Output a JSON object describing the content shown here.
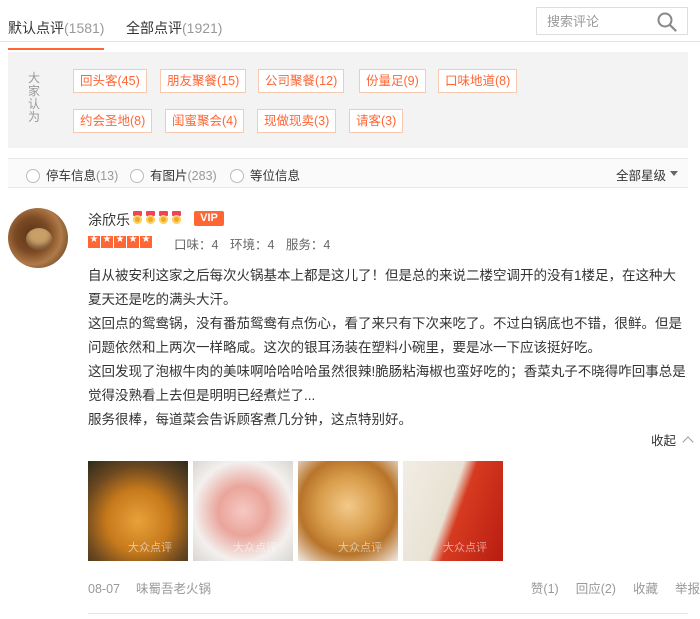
{
  "tabs": [
    {
      "label": "默认点评",
      "count": "(1581)"
    },
    {
      "label": "全部点评",
      "count": "(1921)"
    }
  ],
  "search": {
    "placeholder": "搜索评论"
  },
  "tag_panel": {
    "title": "大家认为",
    "tags": [
      "回头客(45)",
      "朋友聚餐(15)",
      "公司聚餐(12)",
      "份量足(9)",
      "口味地道(8)",
      "约会圣地(8)",
      "闺蜜聚会(4)",
      "现做现卖(3)",
      "请客(3)"
    ]
  },
  "filters": [
    {
      "label": "停车信息",
      "count": "(13)"
    },
    {
      "label": "有图片",
      "count": "(283)"
    },
    {
      "label": "等位信息",
      "count": ""
    }
  ],
  "star_filter": {
    "selected": "全部星级"
  },
  "review": {
    "user": "涂欣乐",
    "vip_label": "VIP",
    "rating_stars": 5,
    "scores": [
      "口味：4",
      "环境：4",
      "服务：4"
    ],
    "paragraphs": [
      "自从被安利这家之后每次火锅基本上都是这儿了！但是总的来说二楼空调开的没有1楼足，在这种大夏天还是吃的满头大汗。",
      "这回点的鸳鸯锅，没有番茄鸳鸯有点伤心，看了来只有下次来吃了。不过白锅底也不错，很鲜。但是问题依然和上两次一样略咸。这次的银耳汤装在塑料小碗里，要是冰一下应该挺好吃。",
      "这回发现了泡椒牛肉的美味啊哈哈哈哈虽然很辣!脆肠粘海椒也蛮好吃的；香菜丸子不晓得咋回事总是觉得没熟看上去但是明明已经煮烂了...",
      "服务很棒，每道菜会告诉顾客煮几分钟，这点特别好。"
    ],
    "collapse_label": "收起",
    "photo_watermark": "大众点评",
    "date": "08-07",
    "shop": "味蜀吾老火锅",
    "actions": [
      "赞(1)",
      "回应(2)",
      "收藏",
      "举报"
    ]
  },
  "colors": {
    "accent": "#ff6633",
    "tag_border": "#f7c9ae",
    "panel_bg": "#f3f3f3"
  }
}
